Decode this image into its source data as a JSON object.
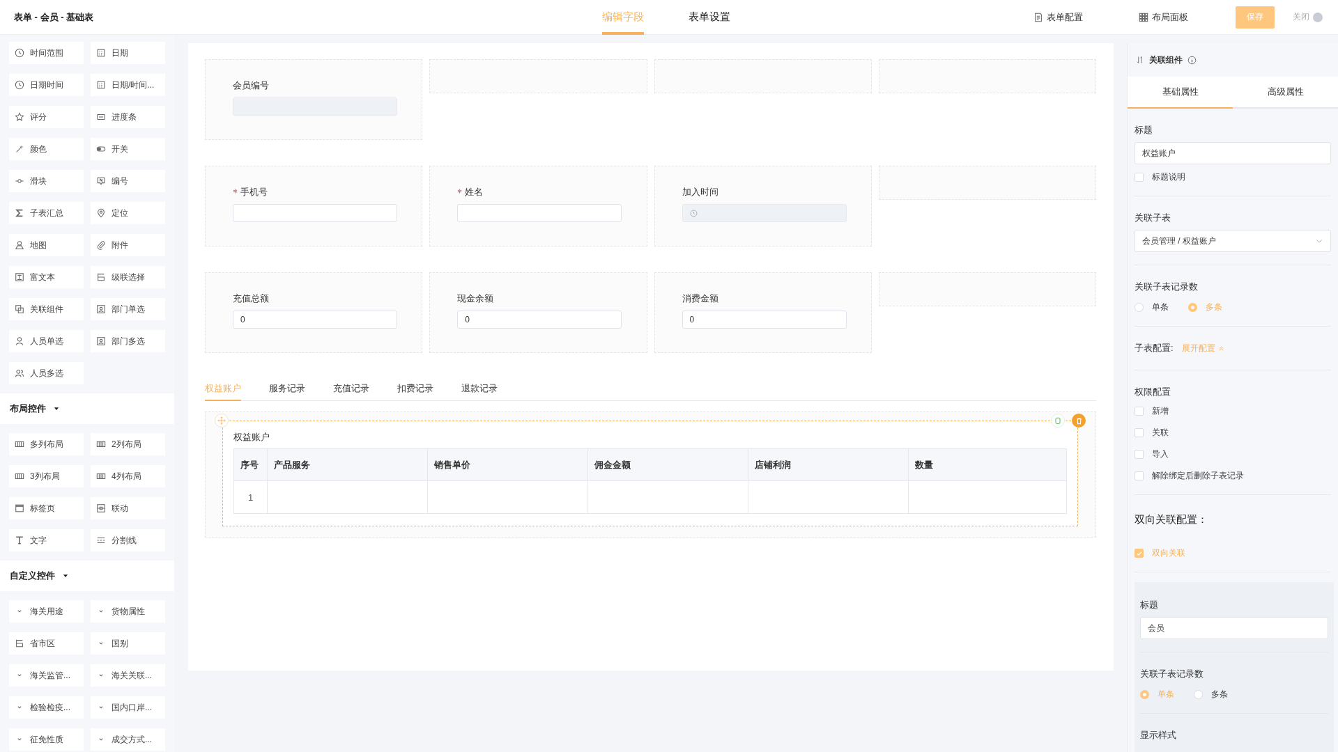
{
  "header": {
    "title": "表单 - 会员 - 基础表",
    "tabs": [
      {
        "label": "编辑字段",
        "selected": true
      },
      {
        "label": "表单设置",
        "selected": false
      }
    ],
    "actions": [
      {
        "kind": "form-config",
        "label": "表单配置"
      },
      {
        "kind": "layout-panel",
        "label": "布局面板"
      }
    ],
    "save_button": "保存",
    "close_button": "关闭"
  },
  "sidebar": {
    "sections": [
      {
        "items": [
          {
            "kind": "clock",
            "label": "时间范围"
          },
          {
            "kind": "calendar",
            "label": "日期"
          },
          {
            "kind": "clock",
            "label": "日期时间"
          },
          {
            "kind": "calendar",
            "label": "日期/时间..."
          },
          {
            "kind": "star",
            "label": "评分"
          },
          {
            "kind": "progress",
            "label": "进度条"
          },
          {
            "kind": "dropper",
            "label": "颜色"
          },
          {
            "kind": "toggle",
            "label": "开关"
          },
          {
            "kind": "slider",
            "label": "滑块"
          },
          {
            "kind": "number",
            "label": "编号"
          },
          {
            "kind": "sigma",
            "label": "子表汇总"
          },
          {
            "kind": "pin",
            "label": "定位"
          },
          {
            "kind": "map",
            "label": "地图"
          },
          {
            "kind": "clip",
            "label": "附件"
          },
          {
            "kind": "richtext",
            "label": "富文本"
          },
          {
            "kind": "cascade",
            "label": "级联选择"
          },
          {
            "kind": "link",
            "label": "关联组件"
          },
          {
            "kind": "dept",
            "label": "部门单选"
          },
          {
            "kind": "person",
            "label": "人员单选"
          },
          {
            "kind": "dept",
            "label": "部门多选"
          },
          {
            "kind": "persons",
            "label": "人员多选"
          }
        ]
      },
      {
        "title": "布局控件",
        "expanded": true,
        "items": [
          {
            "kind": "columns",
            "label": "多列布局"
          },
          {
            "kind": "columns",
            "label": "2列布局"
          },
          {
            "kind": "columns",
            "label": "3列布局"
          },
          {
            "kind": "columns",
            "label": "4列布局"
          },
          {
            "kind": "tabs",
            "label": "标签页"
          },
          {
            "kind": "linkage",
            "label": "联动"
          },
          {
            "kind": "text",
            "label": "文字"
          },
          {
            "kind": "divider",
            "label": "分割线"
          }
        ]
      },
      {
        "title": "自定义控件",
        "expanded": true,
        "items": [
          {
            "kind": "chevron",
            "label": "海关用途"
          },
          {
            "kind": "chevron",
            "label": "货物属性"
          },
          {
            "kind": "cascade",
            "label": "省市区"
          },
          {
            "kind": "chevron",
            "label": "国别"
          },
          {
            "kind": "chevron",
            "label": "海关监管..."
          },
          {
            "kind": "chevron",
            "label": "海关关联..."
          },
          {
            "kind": "chevron",
            "label": "检验检疫..."
          },
          {
            "kind": "chevron",
            "label": "国内口岸..."
          },
          {
            "kind": "chevron",
            "label": "征免性质"
          },
          {
            "kind": "chevron",
            "label": "成交方式..."
          }
        ]
      }
    ]
  },
  "form": {
    "rows": [
      [
        {
          "kind": "field",
          "label": "会员编号",
          "required": false,
          "disabled": true
        },
        {
          "kind": "empty"
        },
        {
          "kind": "empty"
        },
        {
          "kind": "empty"
        }
      ],
      [
        {
          "kind": "field",
          "label": "手机号",
          "required": true,
          "disabled": false
        },
        {
          "kind": "field",
          "label": "姓名",
          "required": true,
          "disabled": false
        },
        {
          "kind": "datetime",
          "label": "加入时间",
          "required": false,
          "disabled": true
        },
        {
          "kind": "empty"
        }
      ],
      [
        {
          "kind": "field",
          "label": "充值总额",
          "required": false,
          "disabled": false,
          "value": "0"
        },
        {
          "kind": "field",
          "label": "现金余额",
          "required": false,
          "disabled": false,
          "value": "0"
        },
        {
          "kind": "field",
          "label": "消费金额",
          "required": false,
          "disabled": false,
          "value": "0"
        },
        {
          "kind": "empty"
        }
      ]
    ]
  },
  "subform": {
    "tabs": [
      {
        "label": "权益账户",
        "selected": true
      },
      {
        "label": "服务记录",
        "selected": false
      },
      {
        "label": "充值记录",
        "selected": false
      },
      {
        "label": "扣费记录",
        "selected": false
      },
      {
        "label": "退款记录",
        "selected": false
      }
    ],
    "title": "权益账户",
    "columns": [
      "序号",
      "产品服务",
      "销售单价",
      "佣金金额",
      "店铺利润",
      "数量"
    ],
    "rows": [
      [
        "1"
      ]
    ]
  },
  "properties": {
    "title": "关联组件",
    "tabs": [
      {
        "label": "基础属性",
        "selected": true
      },
      {
        "label": "高级属性",
        "selected": false
      }
    ],
    "title_field": {
      "label": "标题",
      "value": "权益账户"
    },
    "title_note": {
      "label": "标题说明",
      "checked": false
    },
    "subtable": {
      "label": "关联子表",
      "value": "会员管理 / 权益账户"
    },
    "record_count": {
      "label": "关联子表记录数",
      "options": [
        {
          "label": "单条",
          "selected": false
        },
        {
          "label": "多条",
          "selected": true
        }
      ]
    },
    "subtable_config": {
      "label": "子表配置:",
      "link": "展开配置",
      "expanded": true
    },
    "permissions": {
      "label": "权限配置",
      "options": [
        {
          "label": "新增",
          "checked": false
        },
        {
          "label": "关联",
          "checked": false
        },
        {
          "label": "导入",
          "checked": false
        },
        {
          "label": "解除绑定后删除子表记录",
          "checked": false
        }
      ]
    },
    "two_way": {
      "label": "双向关联配置：",
      "toggle": {
        "label": "双向关联",
        "checked": true
      },
      "title_field": {
        "label": "标题",
        "value": "会员"
      },
      "record_count": {
        "label": "关联子表记录数",
        "options": [
          {
            "label": "单条",
            "selected": true
          },
          {
            "label": "多条",
            "selected": false
          }
        ]
      },
      "display_style": {
        "label": "显示样式"
      }
    }
  }
}
